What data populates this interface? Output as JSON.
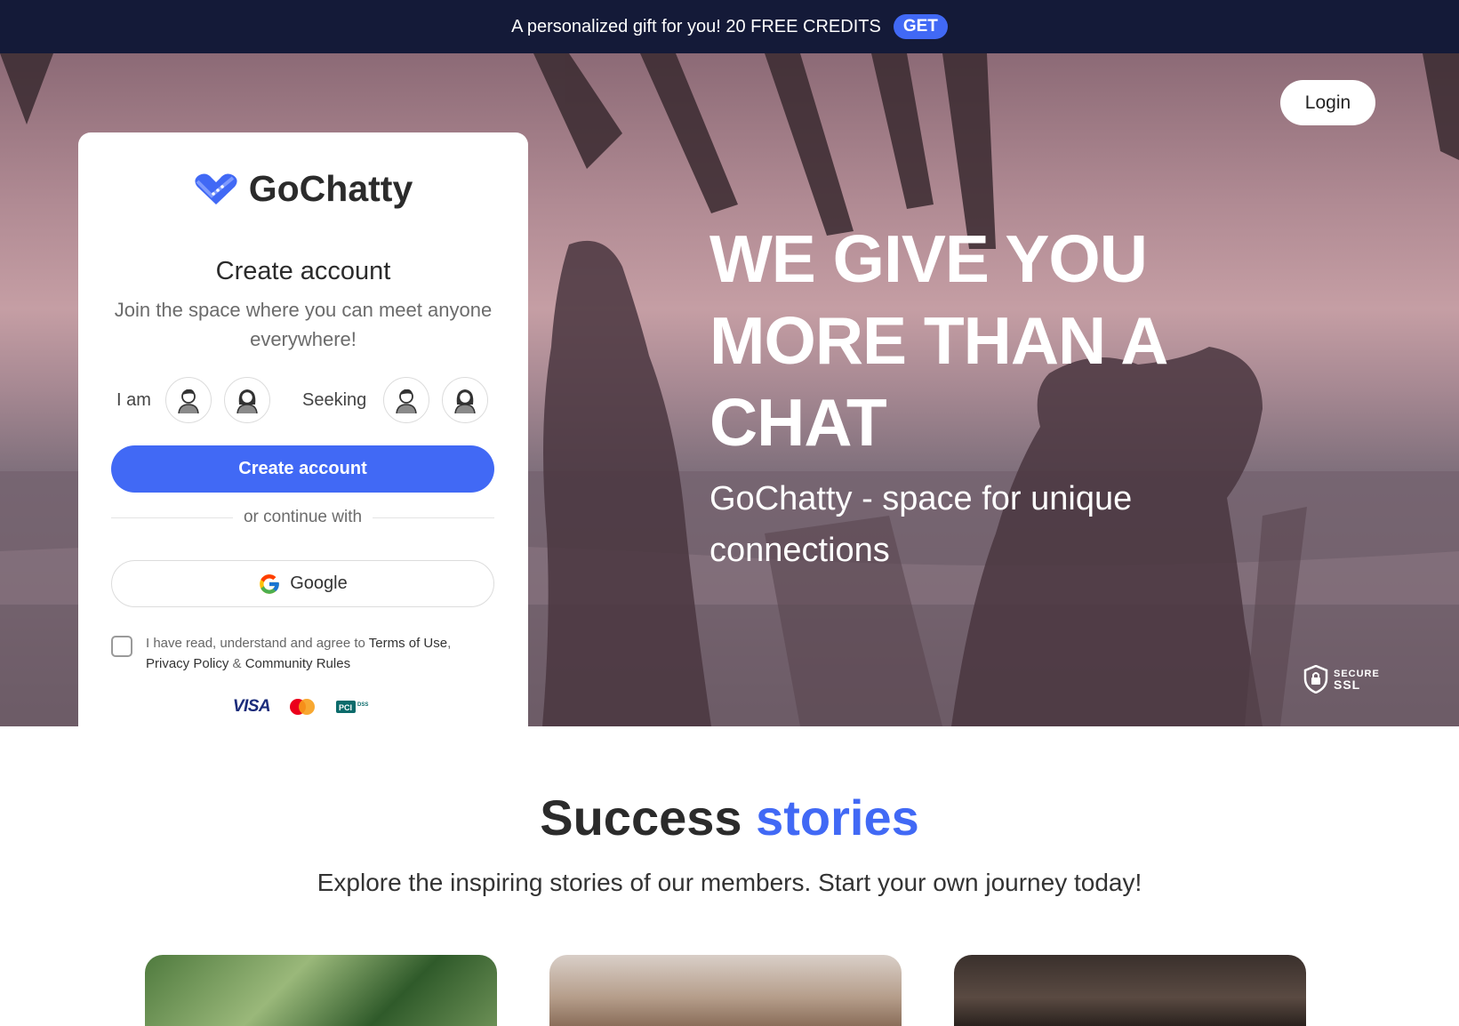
{
  "promo": {
    "text": "A personalized gift for you! 20 FREE CREDITS",
    "cta": "GET"
  },
  "header": {
    "login_label": "Login"
  },
  "hero": {
    "title": "WE GIVE YOU MORE THAN A CHAT",
    "subtitle": "GoChatty - space for unique connections",
    "ssl_line1": "SECURE",
    "ssl_line2": "SSL"
  },
  "signup": {
    "brand": "GoChatty",
    "title": "Create account",
    "subtitle": "Join the space where you can meet anyone everywhere!",
    "i_am_label": "I am",
    "seeking_label": "Seeking",
    "create_label": "Create account",
    "divider_label": "or continue with",
    "google_label": "Google",
    "terms_prefix": "I have read, understand and agree to ",
    "terms_of_use": "Terms of Use",
    "terms_comma": ",",
    "privacy_policy": "Privacy Policy",
    "terms_amp": " & ",
    "community_rules": "Community Rules",
    "payments": {
      "visa": "VISA",
      "pci": "PCI",
      "pci_small": "DSS"
    }
  },
  "success": {
    "title_main": "Success",
    "title_accent": "stories",
    "subtitle": "Explore the inspiring stories of our members. Start your own journey today!"
  },
  "colors": {
    "accent": "#4169f5",
    "promo_bg": "#141a38"
  }
}
